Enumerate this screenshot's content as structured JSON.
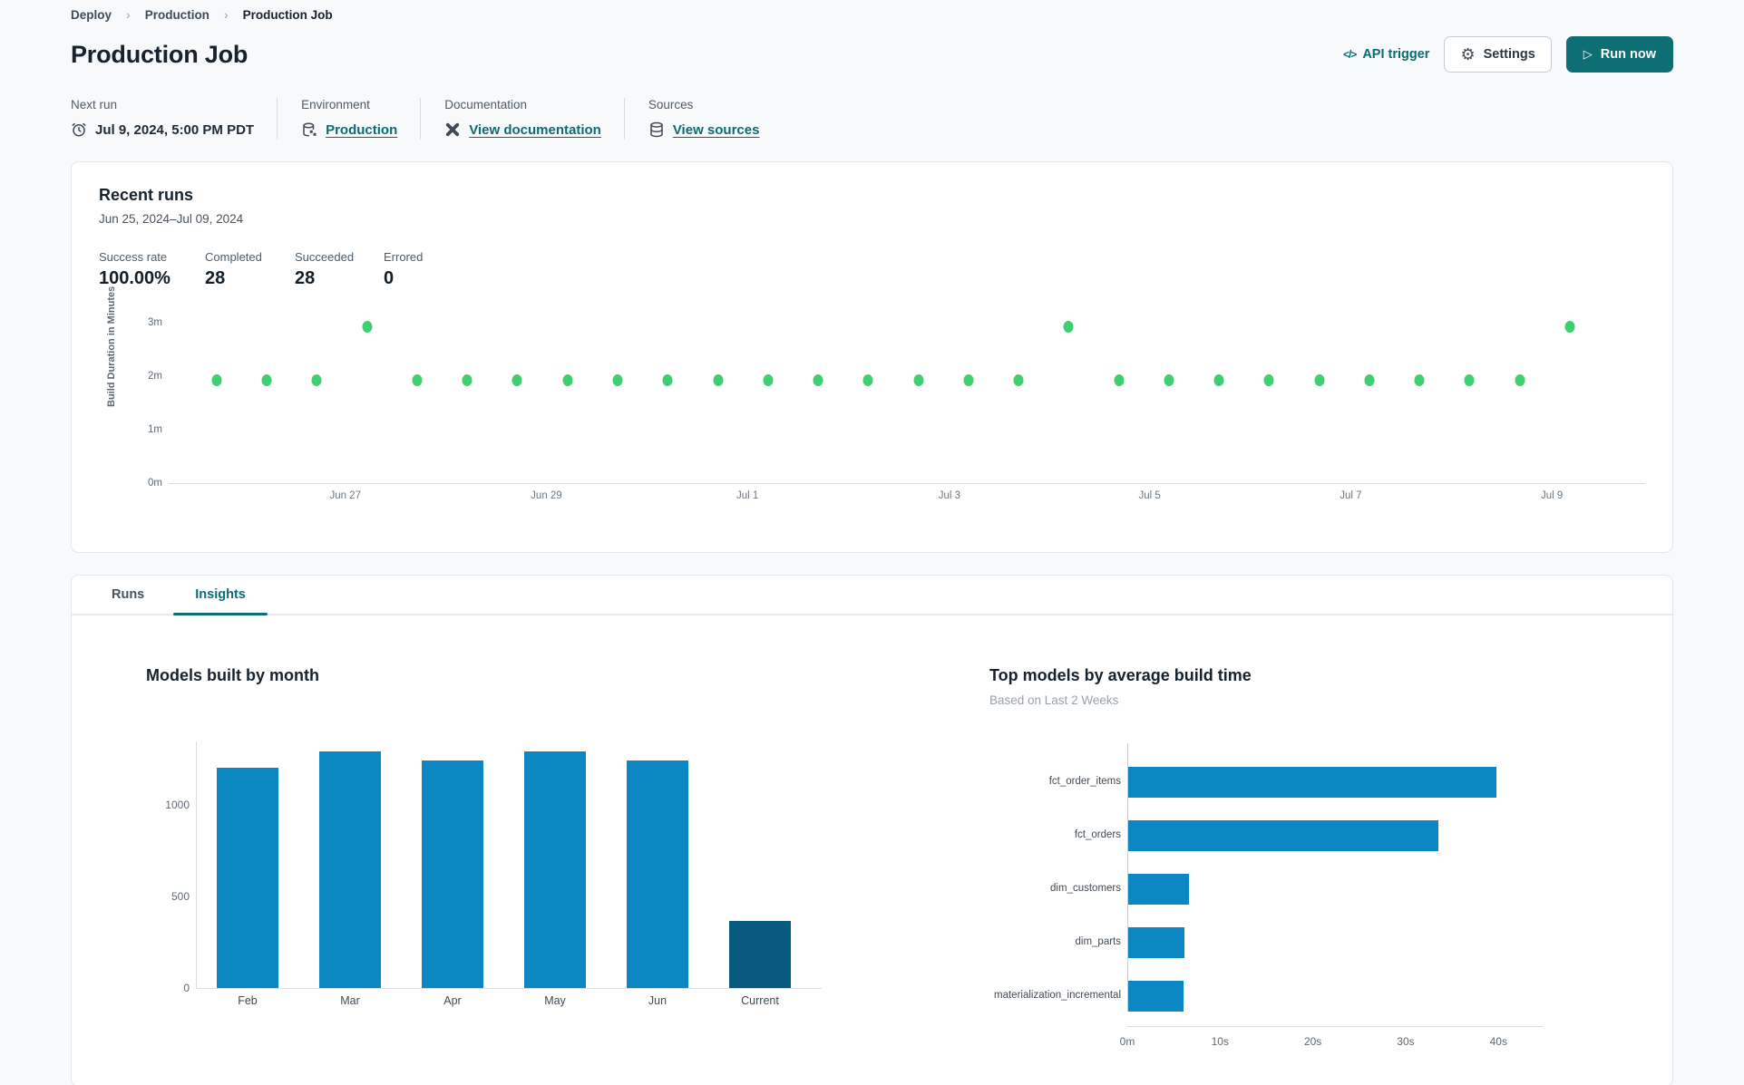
{
  "colors": {
    "accent_teal": "#0d6e74",
    "link_teal": "#0c6b71",
    "bar_blue": "#0d87c3",
    "bar_dark_blue": "#07597f",
    "dot_green": "#3dcf70"
  },
  "breadcrumb": {
    "items": [
      {
        "label": "Deploy"
      },
      {
        "label": "Production"
      },
      {
        "label": "Production Job"
      }
    ],
    "separator": "›"
  },
  "header": {
    "title": "Production Job",
    "api_trigger_label": "API trigger",
    "api_trigger_icon": "</>",
    "settings_label": "Settings",
    "run_now_label": "Run now"
  },
  "info_bar": {
    "items": [
      {
        "label": "Next run",
        "value": "Jul 9, 2024, 5:00 PM PDT",
        "icon": "alarm-clock-icon",
        "is_link": false
      },
      {
        "label": "Environment",
        "value": "Production",
        "icon": "environment-icon",
        "is_link": true
      },
      {
        "label": "Documentation",
        "value": "View documentation",
        "icon": "dbt-logo-icon",
        "is_link": true
      },
      {
        "label": "Sources",
        "value": "View sources",
        "icon": "database-icon",
        "is_link": true
      }
    ]
  },
  "recent_runs": {
    "title": "Recent runs",
    "date_range": "Jun 25, 2024–Jul 09, 2024",
    "stats": [
      {
        "label": "Success rate",
        "value": "100.00%"
      },
      {
        "label": "Completed",
        "value": "28"
      },
      {
        "label": "Succeeded",
        "value": "28"
      },
      {
        "label": "Errored",
        "value": "0"
      }
    ]
  },
  "tabs": [
    {
      "label": "Runs",
      "active": false
    },
    {
      "label": "Insights",
      "active": true
    }
  ],
  "chart_data": [
    {
      "type": "scatter",
      "name": "run-duration-scatter",
      "ylabel": "Build Duration in Minutes",
      "y_ticks": [
        {
          "label": "0m",
          "minutes": 0
        },
        {
          "label": "1m",
          "minutes": 1
        },
        {
          "label": "2m",
          "minutes": 2
        },
        {
          "label": "3m",
          "minutes": 3
        }
      ],
      "ymax_minutes": 3.07,
      "x_ticks": [
        {
          "label": "Jun 27",
          "pct": 11.96
        },
        {
          "label": "Jun 29",
          "pct": 25.58
        },
        {
          "label": "Jul 1",
          "pct": 39.2
        },
        {
          "label": "Jul 3",
          "pct": 52.88
        },
        {
          "label": "Jul 5",
          "pct": 66.44
        },
        {
          "label": "Jul 7",
          "pct": 80.06
        },
        {
          "label": "Jul 9",
          "pct": 93.68
        }
      ],
      "first_dot_pct": 3.25,
      "last_dot_pct": 94.9,
      "durations_minutes": [
        1.95,
        1.95,
        1.95,
        2.95,
        1.95,
        1.95,
        1.95,
        1.95,
        1.95,
        1.95,
        1.95,
        1.95,
        1.95,
        1.95,
        1.95,
        1.95,
        1.95,
        2.95,
        1.95,
        1.95,
        1.95,
        1.95,
        1.95,
        1.95,
        1.95,
        1.95,
        1.95,
        2.95
      ],
      "point_color": "#3dcf70"
    },
    {
      "type": "bar",
      "name": "models-built-by-month",
      "title": "Models built by month",
      "categories": [
        "Feb",
        "Mar",
        "Apr",
        "May",
        "Jun",
        "Current"
      ],
      "values": [
        1200,
        1290,
        1240,
        1290,
        1240,
        365
      ],
      "bar_colors": [
        "#0d87c3",
        "#0d87c3",
        "#0d87c3",
        "#0d87c3",
        "#0d87c3",
        "#07597f"
      ],
      "y_ticks": [
        0,
        500,
        1000
      ],
      "ylim": [
        0,
        1350
      ],
      "grid": false,
      "legend": false
    },
    {
      "type": "bar",
      "orientation": "horizontal",
      "name": "top-models-by-avg-build-time",
      "title": "Top models by average build time",
      "subtitle": "Based on Last 2 Weeks",
      "categories": [
        "fct_order_items",
        "fct_orders",
        "dim_customers",
        "dim_parts",
        "materialization_incremental"
      ],
      "values_seconds": [
        39.7,
        33.4,
        6.5,
        6.1,
        6.0
      ],
      "x_ticks": [
        {
          "label": "0m",
          "sec": 0
        },
        {
          "label": "10s",
          "sec": 10
        },
        {
          "label": "20s",
          "sec": 20
        },
        {
          "label": "30s",
          "sec": 30
        },
        {
          "label": "40s",
          "sec": 40
        }
      ],
      "xlim_seconds": [
        0,
        43
      ],
      "bar_color": "#0d87c3",
      "grid": false,
      "legend": false
    }
  ]
}
